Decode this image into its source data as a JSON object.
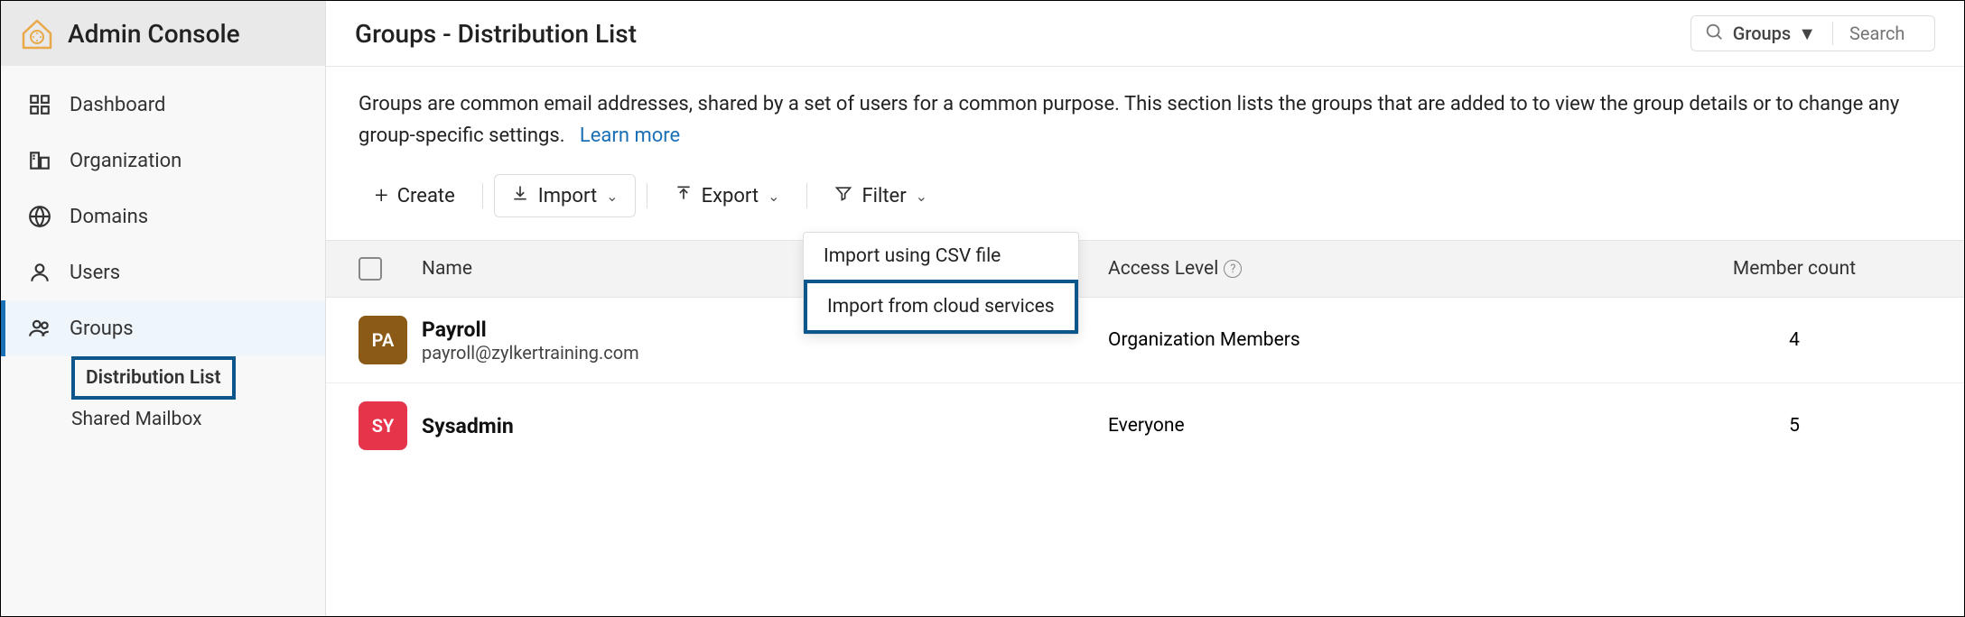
{
  "sidebar": {
    "title": "Admin Console",
    "items": [
      {
        "label": "Dashboard"
      },
      {
        "label": "Organization"
      },
      {
        "label": "Domains"
      },
      {
        "label": "Users"
      },
      {
        "label": "Groups"
      }
    ],
    "subitems": [
      {
        "label": "Distribution List"
      },
      {
        "label": "Shared Mailbox"
      }
    ]
  },
  "header": {
    "title": "Groups - Distribution List",
    "search_filter": "Groups",
    "search_placeholder": "Search"
  },
  "description": {
    "text": "Groups are common email addresses, shared by a set of users for a common purpose. This section lists the groups that are added to to view the group details or to change any group-specific settings.",
    "learn": "Learn more"
  },
  "toolbar": {
    "create": "Create",
    "import": "Import",
    "export": "Export",
    "filter": "Filter"
  },
  "dropdown": {
    "item1": "Import using CSV file",
    "item2": "Import from cloud services"
  },
  "table": {
    "columns": {
      "name": "Name",
      "access": "Access Level",
      "member": "Member count"
    },
    "rows": [
      {
        "initials": "PA",
        "color": "#8a5a16",
        "name": "Payroll",
        "email": "payroll@zylkertraining.com",
        "access": "Organization Members",
        "count": "4"
      },
      {
        "initials": "SY",
        "color": "#e6344a",
        "name": "Sysadmin",
        "email": "",
        "access": "Everyone",
        "count": "5"
      }
    ]
  }
}
